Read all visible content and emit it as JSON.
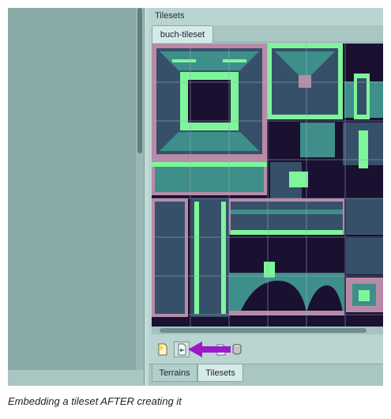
{
  "panel_title": "Tilesets",
  "tileset_tab": "buch-tileset",
  "bottom_tabs": [
    "Terrains",
    "Tilesets"
  ],
  "caption": "Embedding a tileset AFTER creating it",
  "toolbar_icons": [
    "new-tileset-icon",
    "embed-tileset-icon",
    "export-tileset-icon",
    "tileset-properties-icon"
  ],
  "annotation_arrow_color": "#9b19c9",
  "colors": {
    "tile_dark": "#1a1030",
    "tile_teal": "#3e8f8a",
    "tile_slate": "#37506a",
    "tile_green": "#7ff59a",
    "tile_pink": "#b98aa8"
  }
}
